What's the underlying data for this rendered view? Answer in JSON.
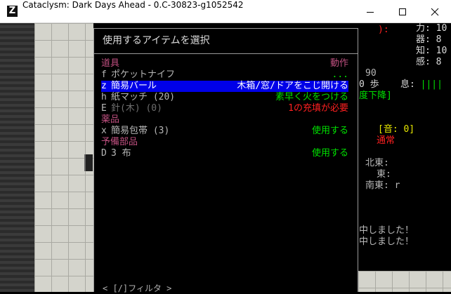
{
  "window": {
    "title": "Cataclysm: Dark Days Ahead - 0.C-30823-g1052542",
    "app_icon": "Z"
  },
  "menu": {
    "title": "使用するアイテムを選択",
    "filter_hint": "< [/]フィルタ >",
    "rows": [
      {
        "key": "",
        "name": "道具",
        "action": "動作",
        "name_color": "#c05080",
        "action_color": "#c05080"
      },
      {
        "key": "f",
        "name": "ポケットナイフ",
        "action": "...",
        "name_color": "#b8b8b8",
        "action_color": "#00e000"
      },
      {
        "key": "z",
        "name": "簡易バール",
        "action": "木箱/窓/ドアをこじ開ける",
        "name_color": "#ffffff",
        "action_color": "#ffffff",
        "selected": true
      },
      {
        "key": "h",
        "name": "紙マッチ (20)",
        "action": "素早く火をつける",
        "name_color": "#b8b8b8",
        "action_color": "#00e000"
      },
      {
        "key": "E",
        "name": "針(木) (0)",
        "action": "1の充填が必要",
        "name_color": "#6e6e6e",
        "action_color": "#ff2020"
      },
      {
        "key": "",
        "name": "薬品",
        "action": "",
        "name_color": "#c05080",
        "action_color": "#c05080"
      },
      {
        "key": "x",
        "name": "簡易包帯 (3)",
        "action": "使用する",
        "name_color": "#b8b8b8",
        "action_color": "#00e000"
      },
      {
        "key": "",
        "name": "予備部品",
        "action": "",
        "name_color": "#c05080",
        "action_color": "#c05080"
      },
      {
        "key": "D",
        "name": "3 布",
        "action": "使用する",
        "name_color": "#b8b8b8",
        "action_color": "#00e000"
      }
    ]
  },
  "sidebar": {
    "paren": "):",
    "stats": [
      "力: 10",
      "器: 8",
      "知: 10",
      "感: 8"
    ],
    "num_90": "90",
    "steps": "0 歩",
    "breath": "息: ||||",
    "decline": "度下降]",
    "sound": "[音: 0]",
    "normal": "通常",
    "compass": [
      "北東:",
      "東:",
      "南東: r"
    ],
    "messages": [
      "中しました！",
      "中しました！"
    ]
  },
  "colors": {
    "header": "#c05080",
    "accent_green": "#00e000",
    "warning_red": "#ff2020",
    "highlight": "#0000e8",
    "sound_yellow": "#e8e800"
  }
}
